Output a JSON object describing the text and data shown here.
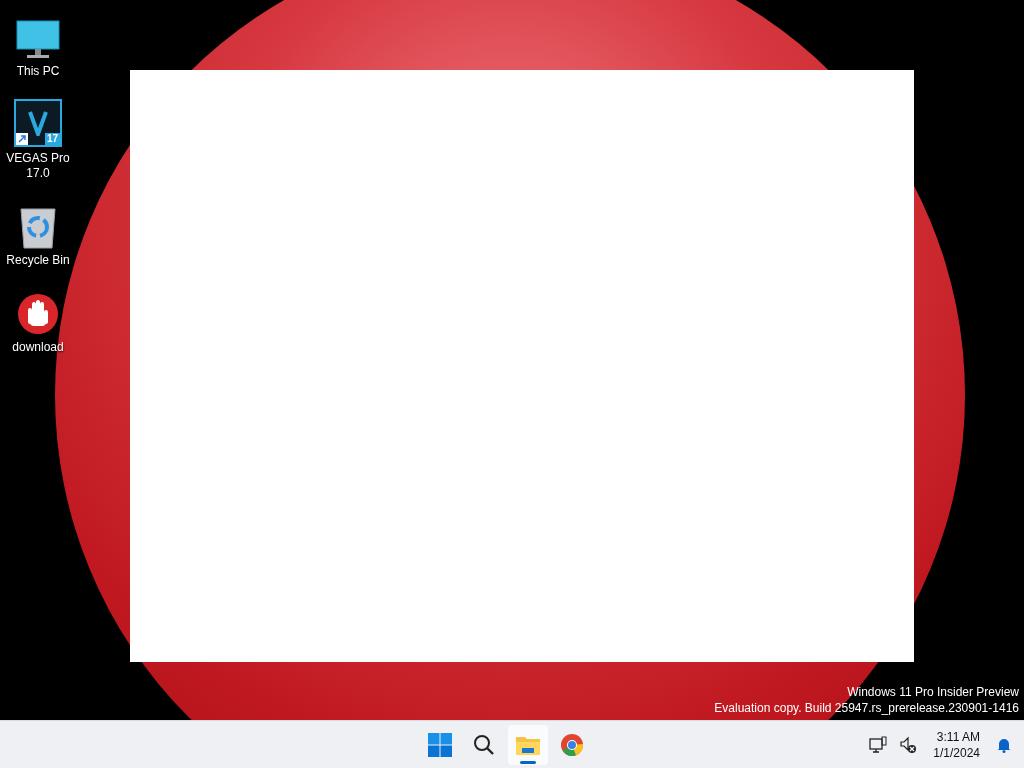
{
  "desktop_icons": [
    {
      "kind": "computer",
      "label": "This PC"
    },
    {
      "kind": "vegas",
      "label": "VEGAS Pro 17.0",
      "badge": "17"
    },
    {
      "kind": "recycle",
      "label": "Recycle Bin"
    },
    {
      "kind": "stop",
      "label": "download"
    }
  ],
  "watermark": {
    "edition": "Windows 11 Pro Insider Preview",
    "build": "Evaluation copy. Build 25947.rs_prerelease.230901-1416"
  },
  "taskbar": {
    "apps": [
      {
        "kind": "start",
        "running": false
      },
      {
        "kind": "search",
        "running": false
      },
      {
        "kind": "explorer",
        "running": true
      },
      {
        "kind": "chrome",
        "running": false
      }
    ],
    "tray": {
      "time": "3:11 AM",
      "date": "1/1/2024"
    }
  }
}
